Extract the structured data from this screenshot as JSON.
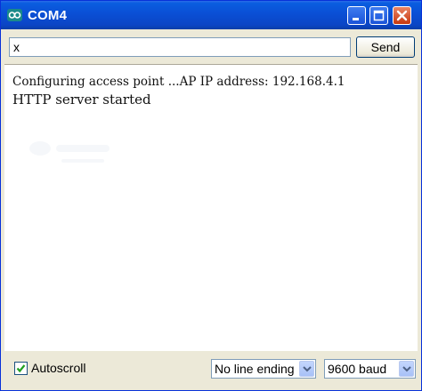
{
  "window": {
    "title": "COM4"
  },
  "titlebar": {
    "icons": [
      "arduino-icon",
      "minimize-icon",
      "maximize-icon",
      "close-icon"
    ]
  },
  "input": {
    "value": "x"
  },
  "toolbar": {
    "send_label": "Send"
  },
  "output": {
    "lines": [
      "Configuring access point ...AP IP address: 192.168.4.1",
      "HTTP server started"
    ]
  },
  "statusbar": {
    "autoscroll_label": "Autoscroll",
    "autoscroll_checked": true,
    "line_ending": "No line ending",
    "baud": "9600 baud"
  },
  "colors": {
    "titlebar": "#0a4fd5",
    "close_button": "#c8380f",
    "chrome": "#ece9d8"
  }
}
